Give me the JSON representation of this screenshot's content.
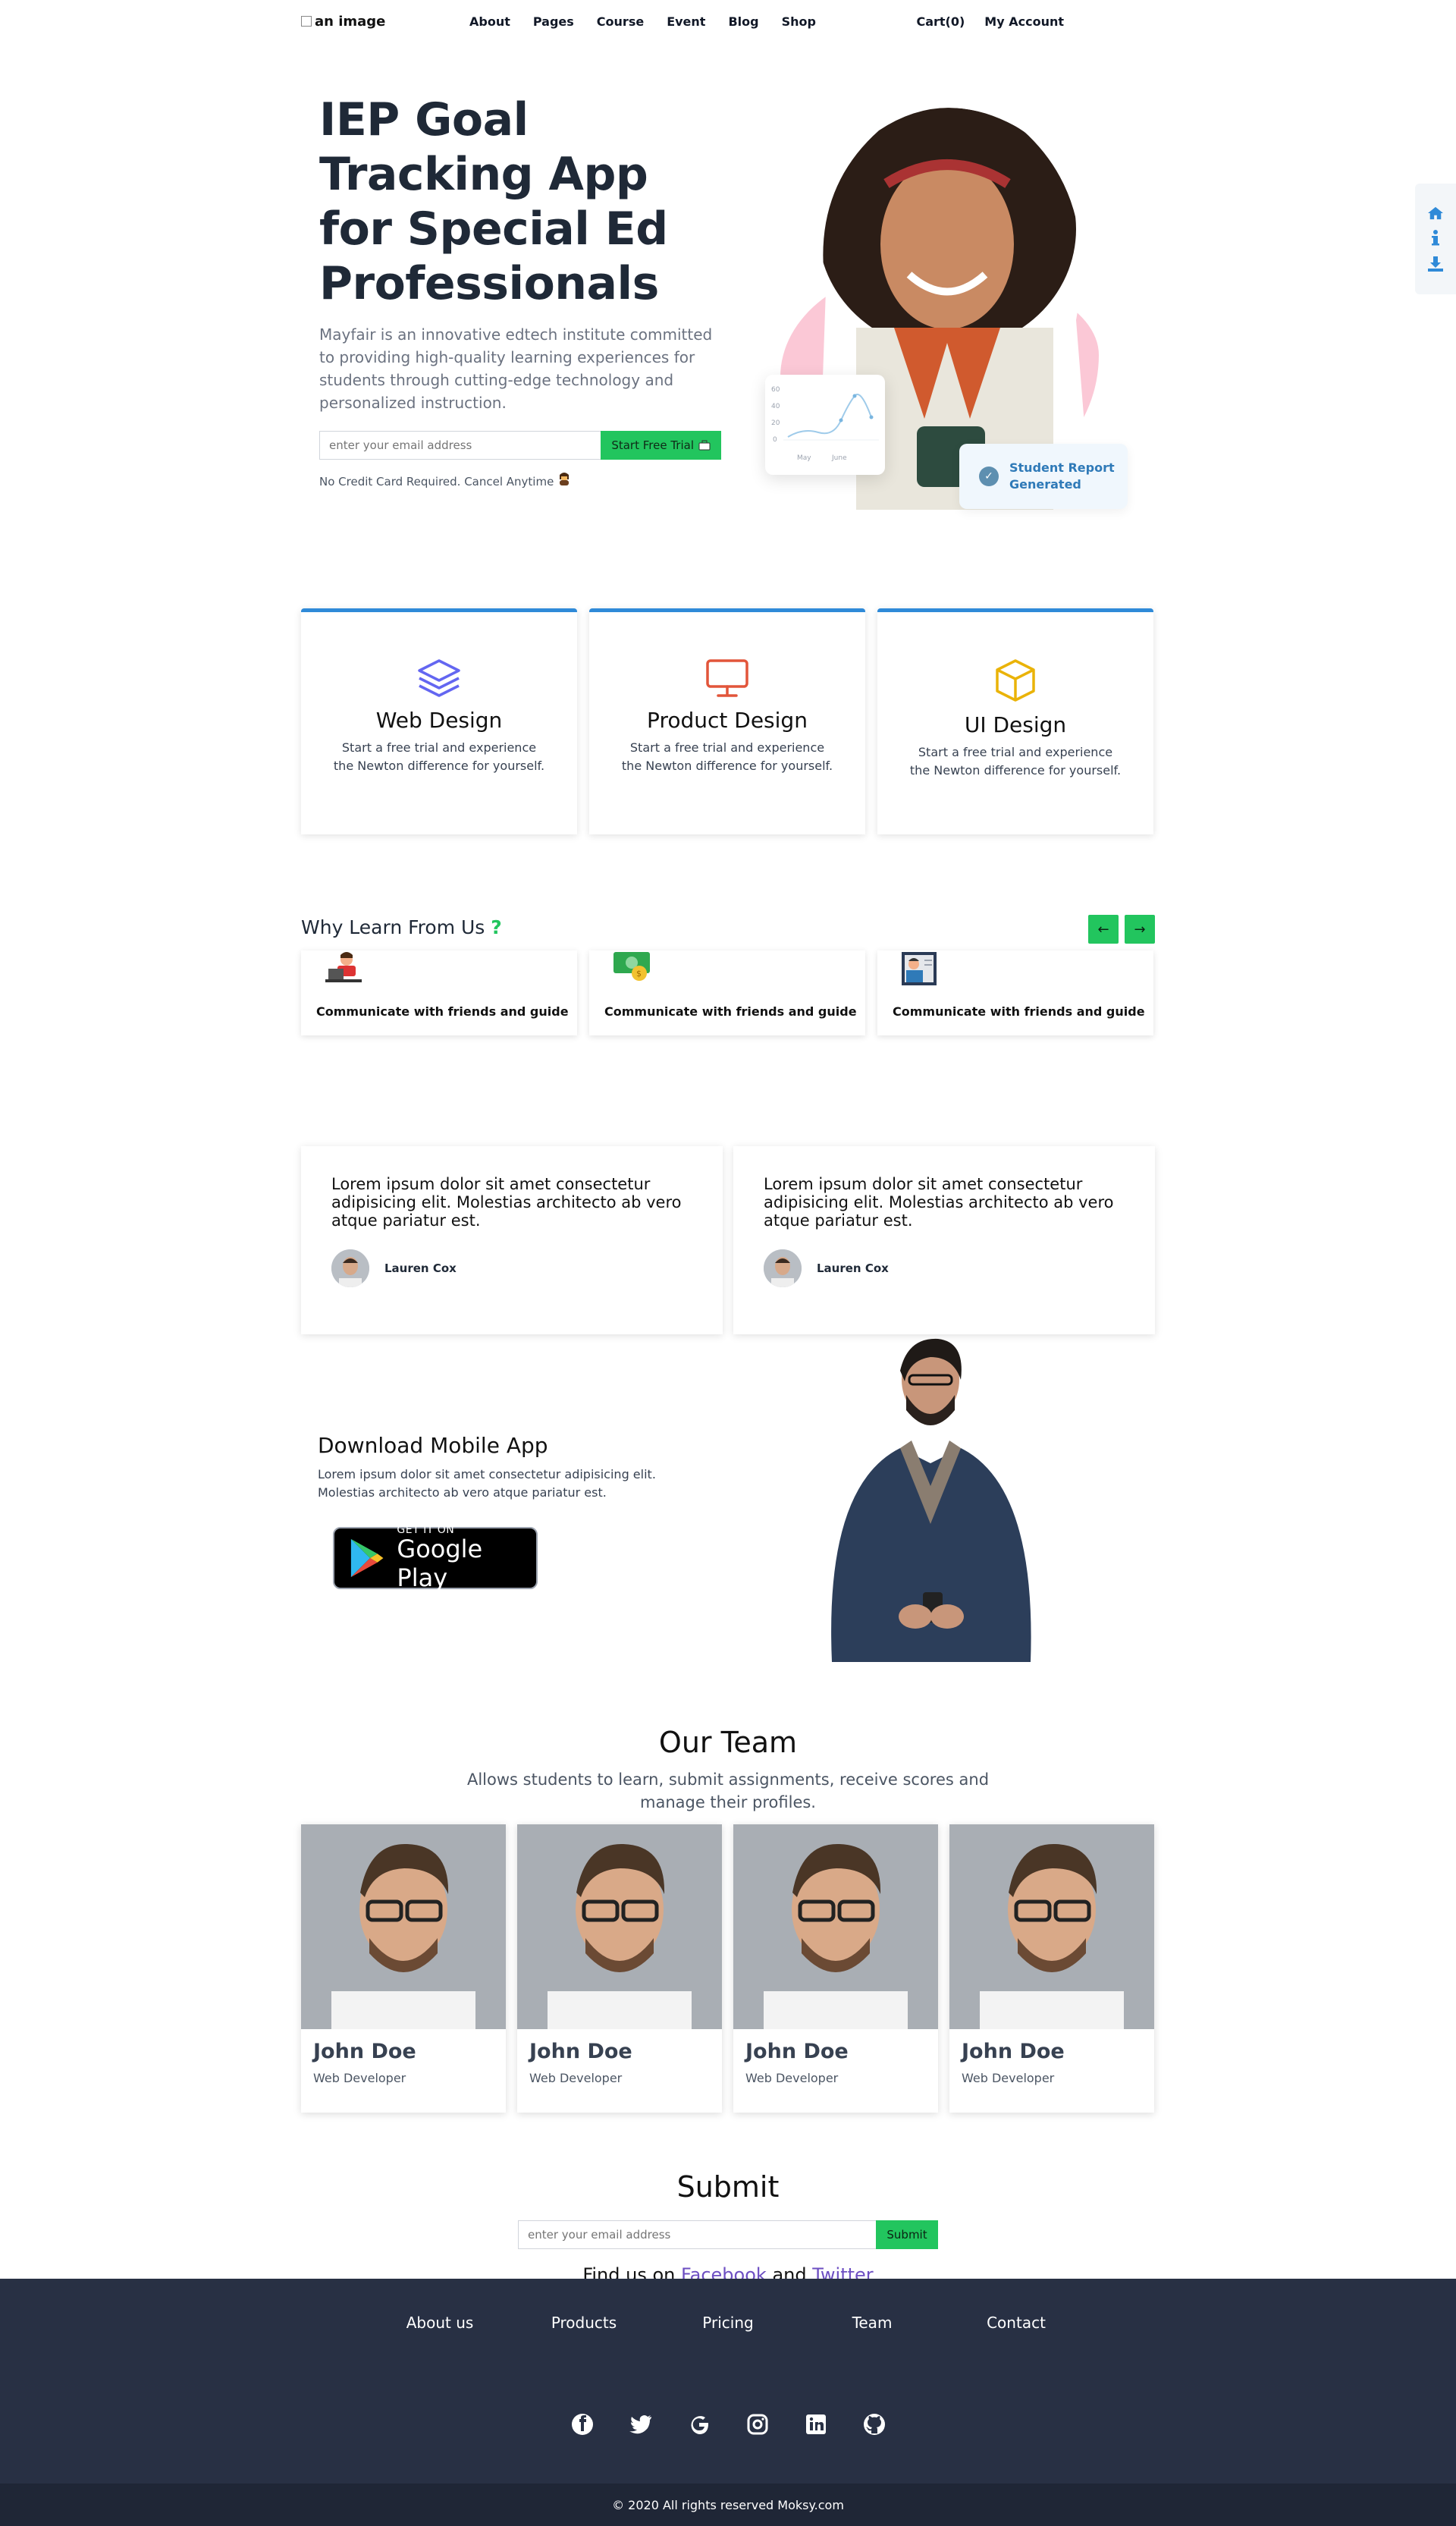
{
  "nav": {
    "logo_alt": "an image",
    "links": [
      "About",
      "Pages",
      "Course",
      "Event",
      "Blog",
      "Shop"
    ],
    "cart": "Cart(0)",
    "account": "My Account"
  },
  "side_widget": {
    "icons": [
      "home-icon",
      "info-icon",
      "download-icon"
    ],
    "color": "#2f8ad8"
  },
  "hero": {
    "title": "IEP Goal Tracking App for Special Ed Professionals",
    "description": "Mayfair is an innovative edtech institute committed to providing high-quality learning experiences for students through cutting-edge technology and personalized instruction.",
    "email_placeholder": "enter your email address",
    "cta_label": "Start Free Trial",
    "note": "No Credit Card Required. Cancel Anytime",
    "chart_y_ticks": [
      "60",
      "40",
      "20",
      "0"
    ],
    "chart_x_ticks": [
      "May",
      "June"
    ],
    "report_text": "Student Report Generated"
  },
  "features": [
    {
      "icon": "layers-icon",
      "title": "Web Design",
      "text": "Start a free trial and experience the Newton difference for yourself.",
      "color": "#6366f1"
    },
    {
      "icon": "monitor-icon",
      "title": "Product Design",
      "text": "Start a free trial and experience the Newton difference for yourself.",
      "color": "#e2553a"
    },
    {
      "icon": "box-icon",
      "title": "UI Design",
      "text": "Start a free trial and experience the Newton difference for yourself.",
      "color": "#eab308"
    }
  ],
  "why": {
    "title": "Why Learn From Us",
    "mark": "?",
    "cards": [
      {
        "icon": "developer-icon",
        "label": "Communicate with friends and guide"
      },
      {
        "icon": "money-icon",
        "label": "Communicate with friends and guide"
      },
      {
        "icon": "teacher-icon",
        "label": "Communicate with friends and guide"
      }
    ]
  },
  "testimonials": [
    {
      "text": "Lorem ipsum dolor sit amet consectetur adipisicing elit. Molestias architecto ab vero atque pariatur est.",
      "author": "Lauren Cox"
    },
    {
      "text": "Lorem ipsum dolor sit amet consectetur adipisicing elit. Molestias architecto ab vero atque pariatur est.",
      "author": "Lauren Cox"
    }
  ],
  "mobile": {
    "title": "Download Mobile App",
    "text": "Lorem ipsum dolor sit amet consectetur adipisicing elit. Molestias architecto ab vero atque pariatur est.",
    "store_small": "GET IT ON",
    "store_big": "Google Play"
  },
  "team": {
    "title": "Our Team",
    "subtitle": "Allows students to learn, submit assignments, receive scores and manage their profiles.",
    "members": [
      {
        "name": "John Doe",
        "role": "Web Developer"
      },
      {
        "name": "John Doe",
        "role": "Web Developer"
      },
      {
        "name": "John Doe",
        "role": "Web Developer"
      },
      {
        "name": "John Doe",
        "role": "Web Developer"
      }
    ]
  },
  "submit": {
    "title": "Submit",
    "placeholder": "enter your email address",
    "button": "Submit",
    "find_prefix": "Find us on",
    "facebook": "Facebook",
    "and": "and",
    "twitter": "Twitter"
  },
  "footer": {
    "links": [
      "About us",
      "Products",
      "Pricing",
      "Team",
      "Contact"
    ],
    "socials": [
      "facebook-icon",
      "twitter-icon",
      "google-icon",
      "instagram-icon",
      "linkedin-icon",
      "github-icon"
    ],
    "copyright": "© 2020 All rights reserved Moksy.com"
  },
  "colors": {
    "accent_green": "#22c55e",
    "accent_blue": "#2f8ad8",
    "footer_bg": "#283044",
    "link_purple": "#6d4fc2"
  }
}
